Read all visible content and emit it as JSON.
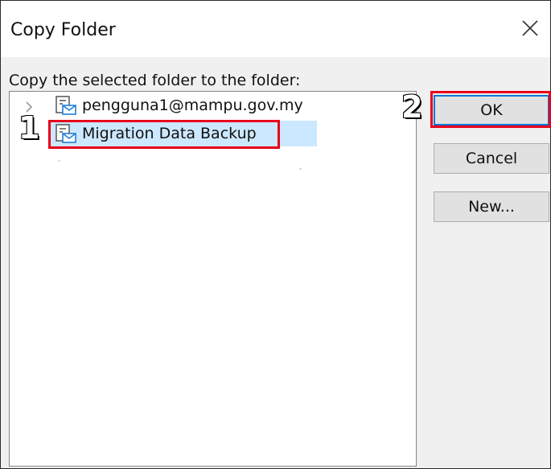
{
  "dialog": {
    "title": "Copy Folder",
    "prompt": "Copy the selected folder to the folder:"
  },
  "tree": {
    "items": [
      {
        "label": "pengguna1@mampu.gov.my",
        "icon": "mailbox-folder-icon",
        "expandable": true,
        "selected": false
      },
      {
        "label": "Migration Data Backup",
        "icon": "mailbox-folder-icon",
        "expandable": false,
        "selected": true
      }
    ]
  },
  "buttons": {
    "ok": "OK",
    "cancel": "Cancel",
    "new": "New..."
  },
  "annotations": {
    "step1": "1",
    "step2": "2",
    "highlight_color": "#e8001c"
  },
  "colors": {
    "selection": "#cce8ff",
    "accent_blue": "#0078d7"
  }
}
